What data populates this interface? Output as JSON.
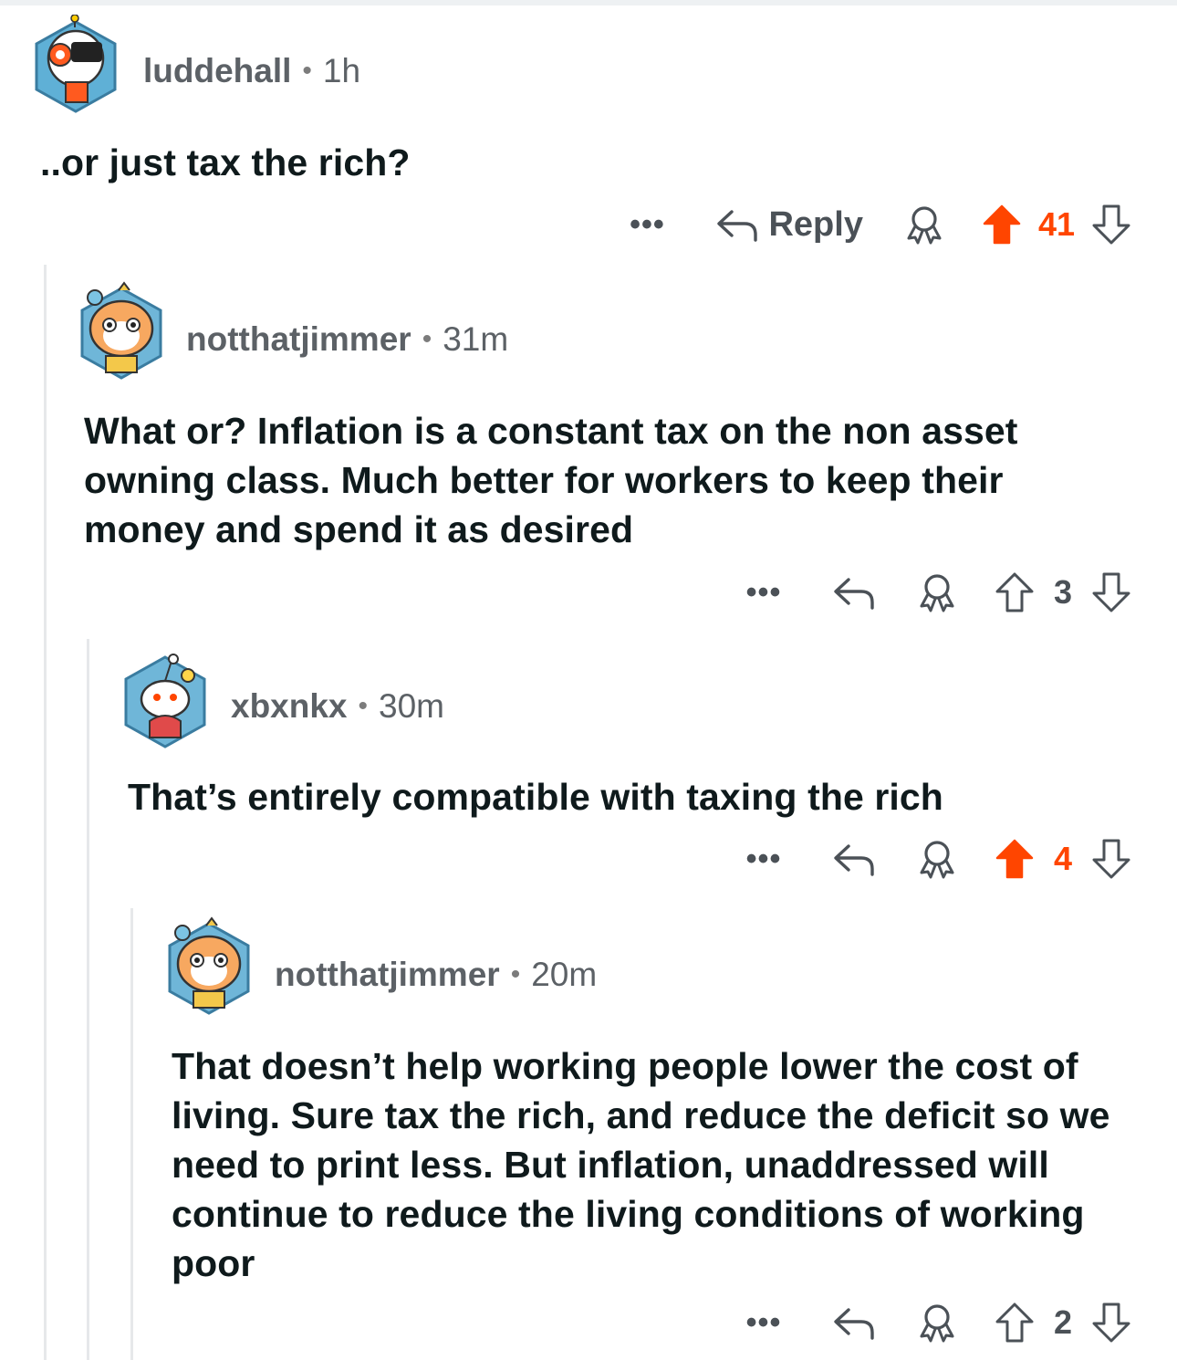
{
  "colors": {
    "upvote_active": "#ff4500",
    "meta_gray": "#5c6166",
    "thread_line": "#e6e8ea"
  },
  "comments": [
    {
      "username": "luddehall",
      "separator": "•",
      "time": "1h",
      "body": "..or just tax the rich?",
      "more_label": "•••",
      "reply_label": "Reply",
      "votes": "41",
      "upvoted": true
    },
    {
      "username": "notthatjimmer",
      "separator": "•",
      "time": "31m",
      "body": "What or? Inflation is a constant tax on the non asset owning class. Much better for workers to keep their money and spend it as desired",
      "more_label": "•••",
      "votes": "3",
      "upvoted": false
    },
    {
      "username": "xbxnkx",
      "separator": "•",
      "time": "30m",
      "body": "That’s entirely compatible with taxing the rich",
      "more_label": "•••",
      "votes": "4",
      "upvoted": true
    },
    {
      "username": "notthatjimmer",
      "separator": "•",
      "time": "20m",
      "body": "That doesn’t help working people lower the cost of living. Sure tax the rich, and reduce the deficit so we need to print less. But inflation, unaddressed will continue to reduce the living conditions of working poor",
      "more_label": "•••",
      "votes": "2",
      "upvoted": false
    }
  ],
  "icons": {
    "avatar": "avatar-icon",
    "more": "more-options-icon",
    "reply": "reply-arrow-icon",
    "award": "award-icon",
    "upvote": "upvote-arrow-icon",
    "downvote": "downvote-arrow-icon"
  }
}
